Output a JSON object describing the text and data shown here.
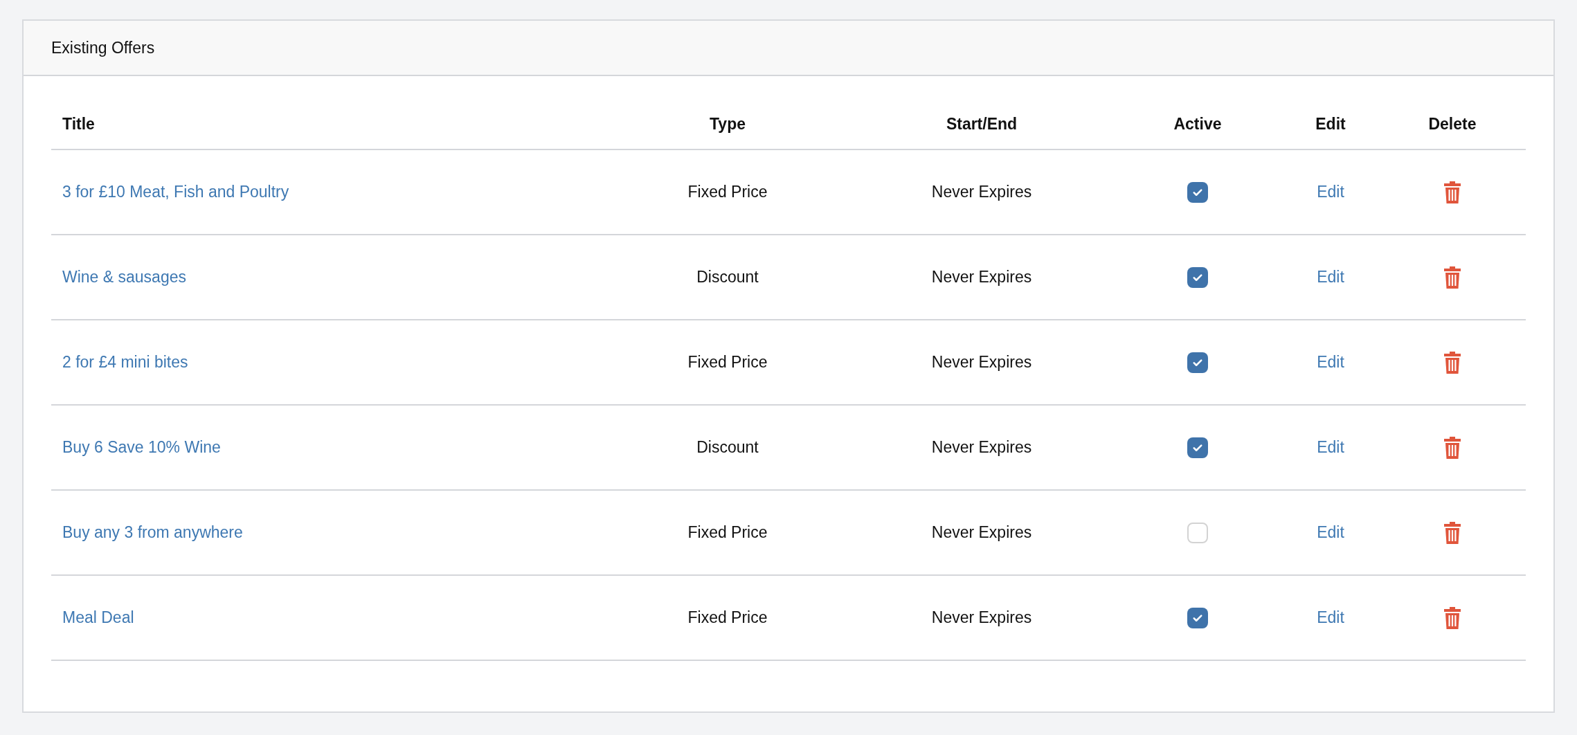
{
  "panel": {
    "title": "Existing Offers"
  },
  "table": {
    "columns": [
      "Title",
      "Type",
      "Start/End",
      "Active",
      "Edit",
      "Delete"
    ],
    "rows": [
      {
        "title": "3 for £10 Meat, Fish and Poultry",
        "type": "Fixed Price",
        "start_end": "Never Expires",
        "active": true,
        "edit": "Edit"
      },
      {
        "title": "Wine & sausages",
        "type": "Discount",
        "start_end": "Never Expires",
        "active": true,
        "edit": "Edit"
      },
      {
        "title": "2 for £4 mini bites",
        "type": "Fixed Price",
        "start_end": "Never Expires",
        "active": true,
        "edit": "Edit"
      },
      {
        "title": "Buy 6 Save 10% Wine",
        "type": "Discount",
        "start_end": "Never Expires",
        "active": true,
        "edit": "Edit"
      },
      {
        "title": "Buy any 3 from anywhere",
        "type": "Fixed Price",
        "start_end": "Never Expires",
        "active": false,
        "edit": "Edit"
      },
      {
        "title": "Meal Deal",
        "type": "Fixed Price",
        "start_end": "Never Expires",
        "active": true,
        "edit": "Edit"
      }
    ]
  }
}
